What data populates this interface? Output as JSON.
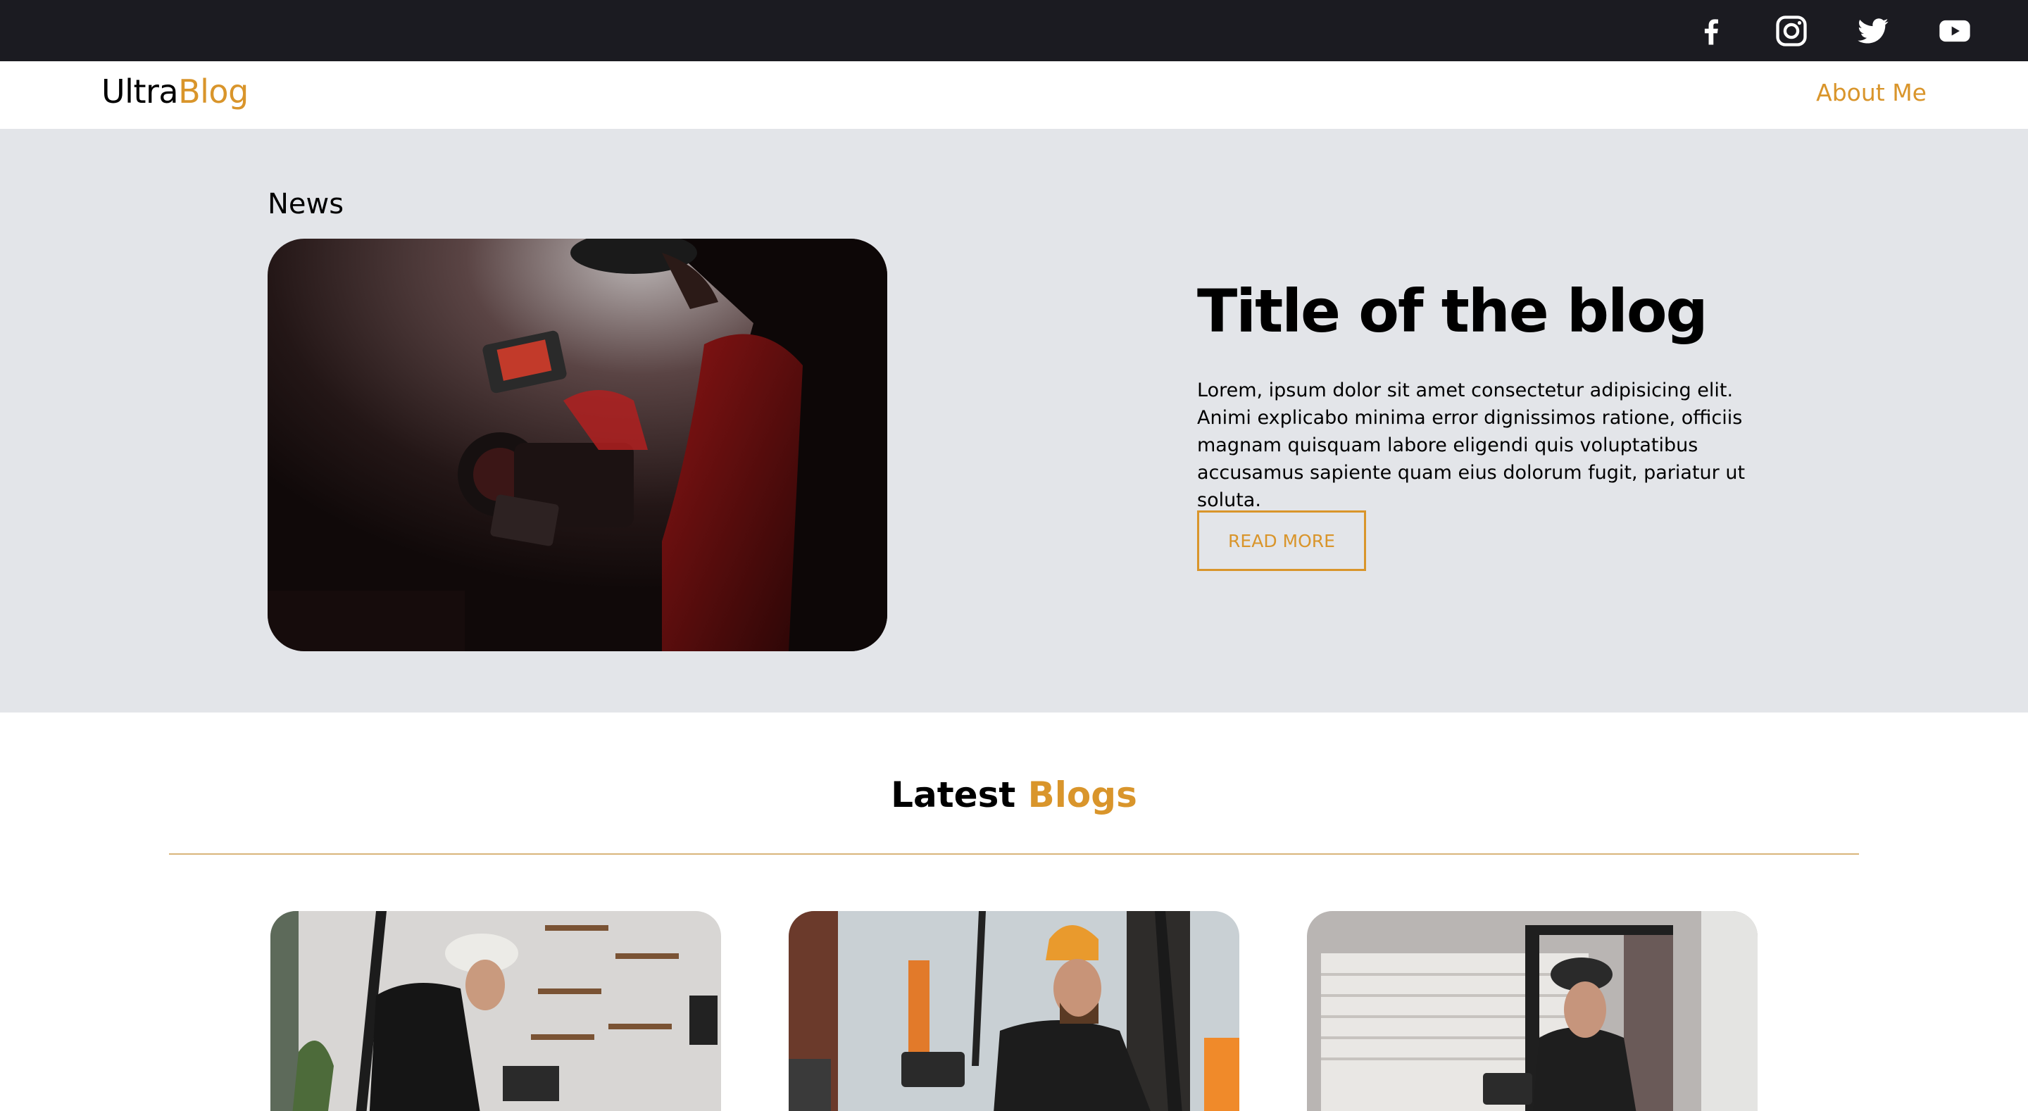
{
  "social": {
    "facebook_icon": "facebook-icon",
    "instagram_icon": "instagram-icon",
    "twitter_icon": "twitter-icon",
    "youtube_icon": "youtube-icon"
  },
  "nav": {
    "logo_primary": "Ultra",
    "logo_accent": "Blog",
    "about_label": "About Me"
  },
  "hero": {
    "section_label": "News",
    "image": "videographer-with-camera-rig-photo",
    "title": "Title of the blog",
    "excerpt": "Lorem, ipsum dolor sit amet consectetur adipisicing elit. Animi explicabo minima error dignissimos ratione, officiis magnam quisquam labore eligendi quis voluptatibus accusamus sapiente quam eius dolorum fugit, pariatur ut soluta.",
    "button_label": "READ MORE"
  },
  "latest": {
    "title_primary": "Latest",
    "title_accent": "Blogs",
    "cards": [
      {
        "image": "cameraman-in-studio-photo"
      },
      {
        "image": "cameraman-with-orange-beanie-photo"
      },
      {
        "image": "cameraman-near-window-photo"
      }
    ]
  },
  "colors": {
    "accent": "#d9952b",
    "topbar": "#1b1b21",
    "hero_bg": "#e3e5e9",
    "text": "#000000"
  }
}
